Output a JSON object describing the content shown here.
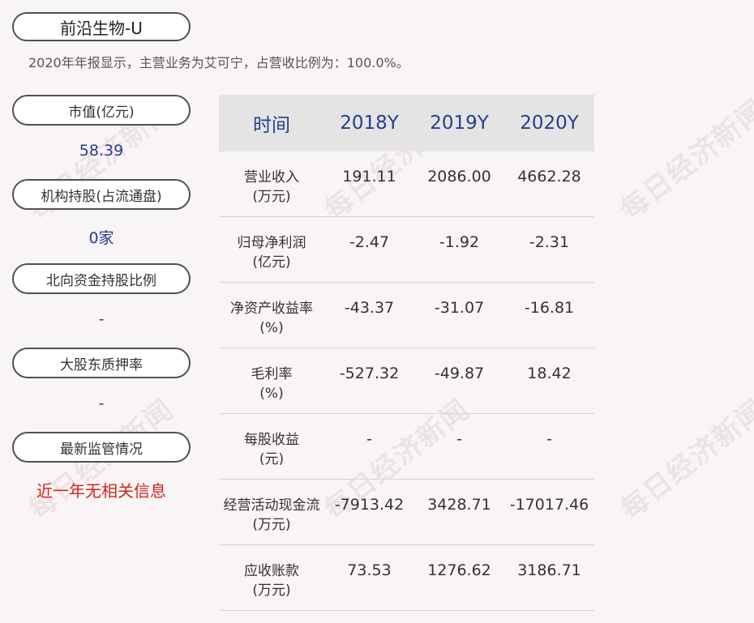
{
  "header": {
    "title": "前沿生物-U",
    "subtitle": "2020年年报显示，主营业务为艾可宁，占营收比例为：100.0%。"
  },
  "left_panel": [
    {
      "label": "市值(亿元)",
      "value": "58.39"
    },
    {
      "label": "机构持股(占流通盘)",
      "value": "0家"
    },
    {
      "label": "北向资金持股比例",
      "value": "-"
    },
    {
      "label": "大股东质押率",
      "value": "-"
    },
    {
      "label": "最新监管情况",
      "value": "近一年无相关信息"
    }
  ],
  "table": {
    "headers": [
      "时间",
      "2018Y",
      "2019Y",
      "2020Y"
    ],
    "rows": [
      {
        "label1": "营业收入",
        "label2": "(万元)",
        "values": [
          "191.11",
          "2086.00",
          "4662.28"
        ]
      },
      {
        "label1": "归母净利润",
        "label2": "(亿元)",
        "values": [
          "-2.47",
          "-1.92",
          "-2.31"
        ]
      },
      {
        "label1": "净资产收益率",
        "label2": "(%)",
        "values": [
          "-43.37",
          "-31.07",
          "-16.81"
        ]
      },
      {
        "label1": "毛利率",
        "label2": "(%)",
        "values": [
          "-527.32",
          "-49.87",
          "18.42"
        ]
      },
      {
        "label1": "每股收益",
        "label2": "(元)",
        "values": [
          "-",
          "-",
          "-"
        ]
      },
      {
        "label1": "经营活动现金流",
        "label2": "(万元)",
        "values": [
          "-7913.42",
          "3428.71",
          "-17017.46"
        ]
      },
      {
        "label1": "应收账款",
        "label2": "(万元)",
        "values": [
          "73.53",
          "1276.62",
          "3186.71"
        ]
      }
    ]
  },
  "watermark": "每日经济新闻"
}
